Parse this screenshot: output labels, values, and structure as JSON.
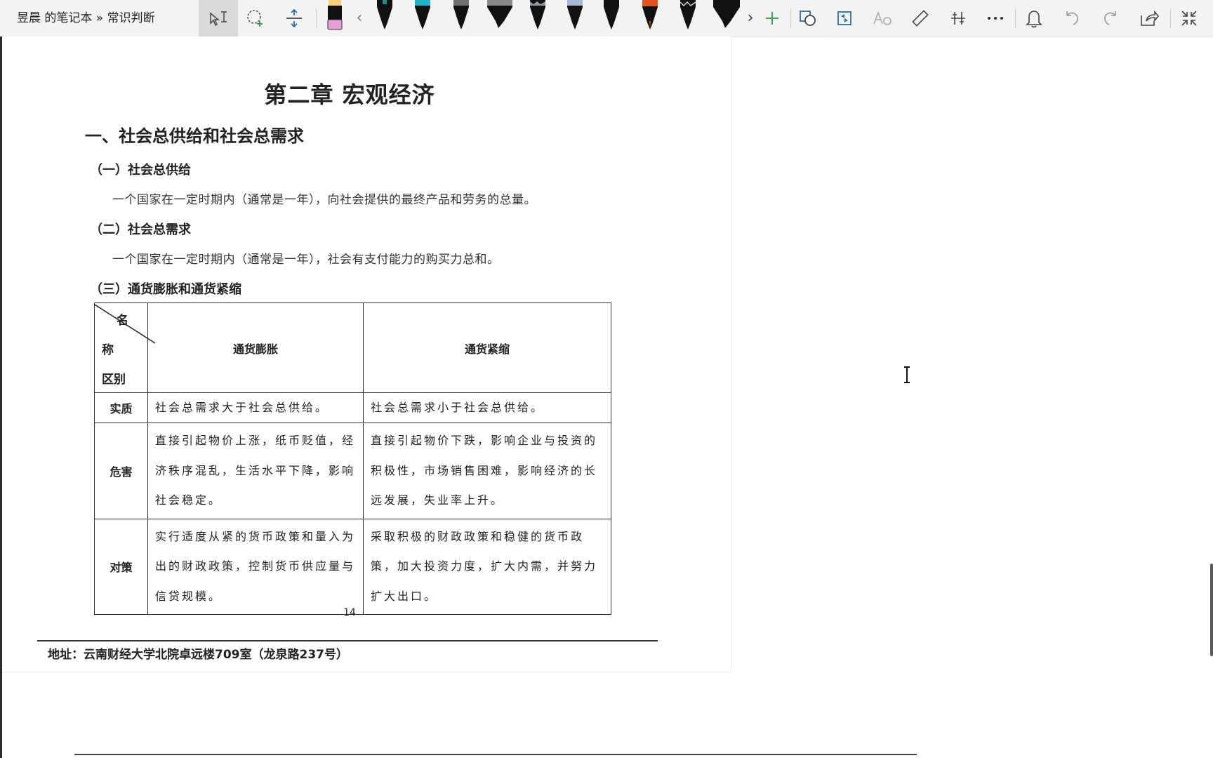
{
  "toolbar": {
    "breadcrumb": "昱晨 的笔记本 » 常识判断",
    "pen_colors": [
      "#f4d27c",
      "#1b1b1b",
      "#22b3c9",
      "#707070",
      "#8a8a8a",
      "#8c9aa6",
      "#a7b6d4",
      "#101010",
      "#e2541d",
      "#1b1b1b",
      "#101010"
    ],
    "highlighter_color": "#e7a0d6",
    "add_color": "#37a84a",
    "icons": [
      "select-text-icon",
      "lasso-select-icon",
      "add-space-icon",
      "add-pen-icon",
      "ink-to-shape-icon",
      "ink-replay-icon",
      "ink-to-text-icon",
      "ruler-icon",
      "adjust-icon",
      "more-icon",
      "bell-icon",
      "undo-icon",
      "redo-icon",
      "share-icon",
      "collapse-icon"
    ]
  },
  "document": {
    "chapter_title": "第二章  宏观经济",
    "section_heading": "一、社会总供给和社会总需求",
    "subsections": [
      {
        "heading": "（一）社会总供给",
        "text": "一个国家在一定时期内（通常是一年），向社会提供的最终产品和劳务的总量。"
      },
      {
        "heading": "（二）社会总需求",
        "text": "一个国家在一定时期内（通常是一年），社会有支付能力的购买力总和。"
      },
      {
        "heading": "（三）通货膨胀和通货紧缩",
        "text": ""
      }
    ],
    "table": {
      "corner": {
        "top": "名",
        "middle": "称",
        "bottom": "区别"
      },
      "columns": [
        "通货膨胀",
        "通货紧缩"
      ],
      "rows": [
        {
          "label": "实质",
          "inflation": "社会总需求大于社会总供给。",
          "deflation": "社会总需求小于社会总供给。"
        },
        {
          "label": "危害",
          "inflation": "直接引起物价上涨，纸币贬值，经济秩序混乱，生活水平下降，影响社会稳定。",
          "deflation": "直接引起物价下跌，影响企业与投资的积极性，市场销售困难，影响经济的长远发展，失业率上升。"
        },
        {
          "label": "对策",
          "inflation": "实行适度从紧的货币政策和量入为出的财政政策，控制货币供应量与信贷规模。",
          "deflation": "采取积极的财政政策和稳健的货币政策，加大投资力度，扩大内需，并努力扩大出口。"
        }
      ]
    },
    "page_number": "14",
    "footer_address": "地址：云南财经大学北院卓远楼709室（龙泉路237号）"
  }
}
